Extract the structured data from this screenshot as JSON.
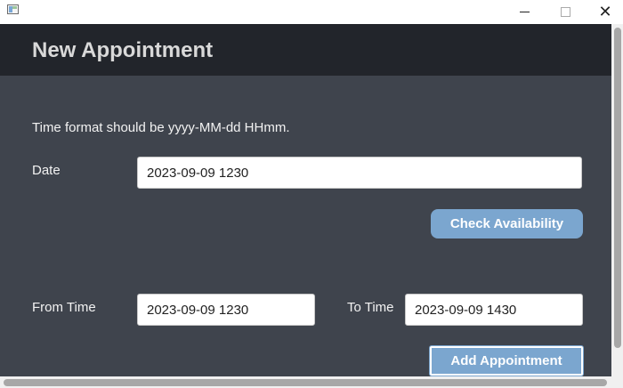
{
  "window": {
    "icon": "app-window-icon",
    "controls": {
      "minimize": "minimize-icon",
      "maximize": "maximize-icon",
      "close_glyph": "✕"
    }
  },
  "header": {
    "title": "New Appointment"
  },
  "form": {
    "hint": "Time format should be yyyy-MM-dd HHmm.",
    "date_label": "Date",
    "date_value": "2023-09-09 1230",
    "check_button": "Check Availability",
    "from_label": "From Time",
    "from_value": "2023-09-09 1230",
    "to_label": "To Time",
    "to_value": "2023-09-09 1430",
    "add_button": "Add Appointment"
  },
  "colors": {
    "header_bg": "#22252b",
    "content_bg": "#3f444d",
    "button_bg": "#7ba6cf"
  }
}
